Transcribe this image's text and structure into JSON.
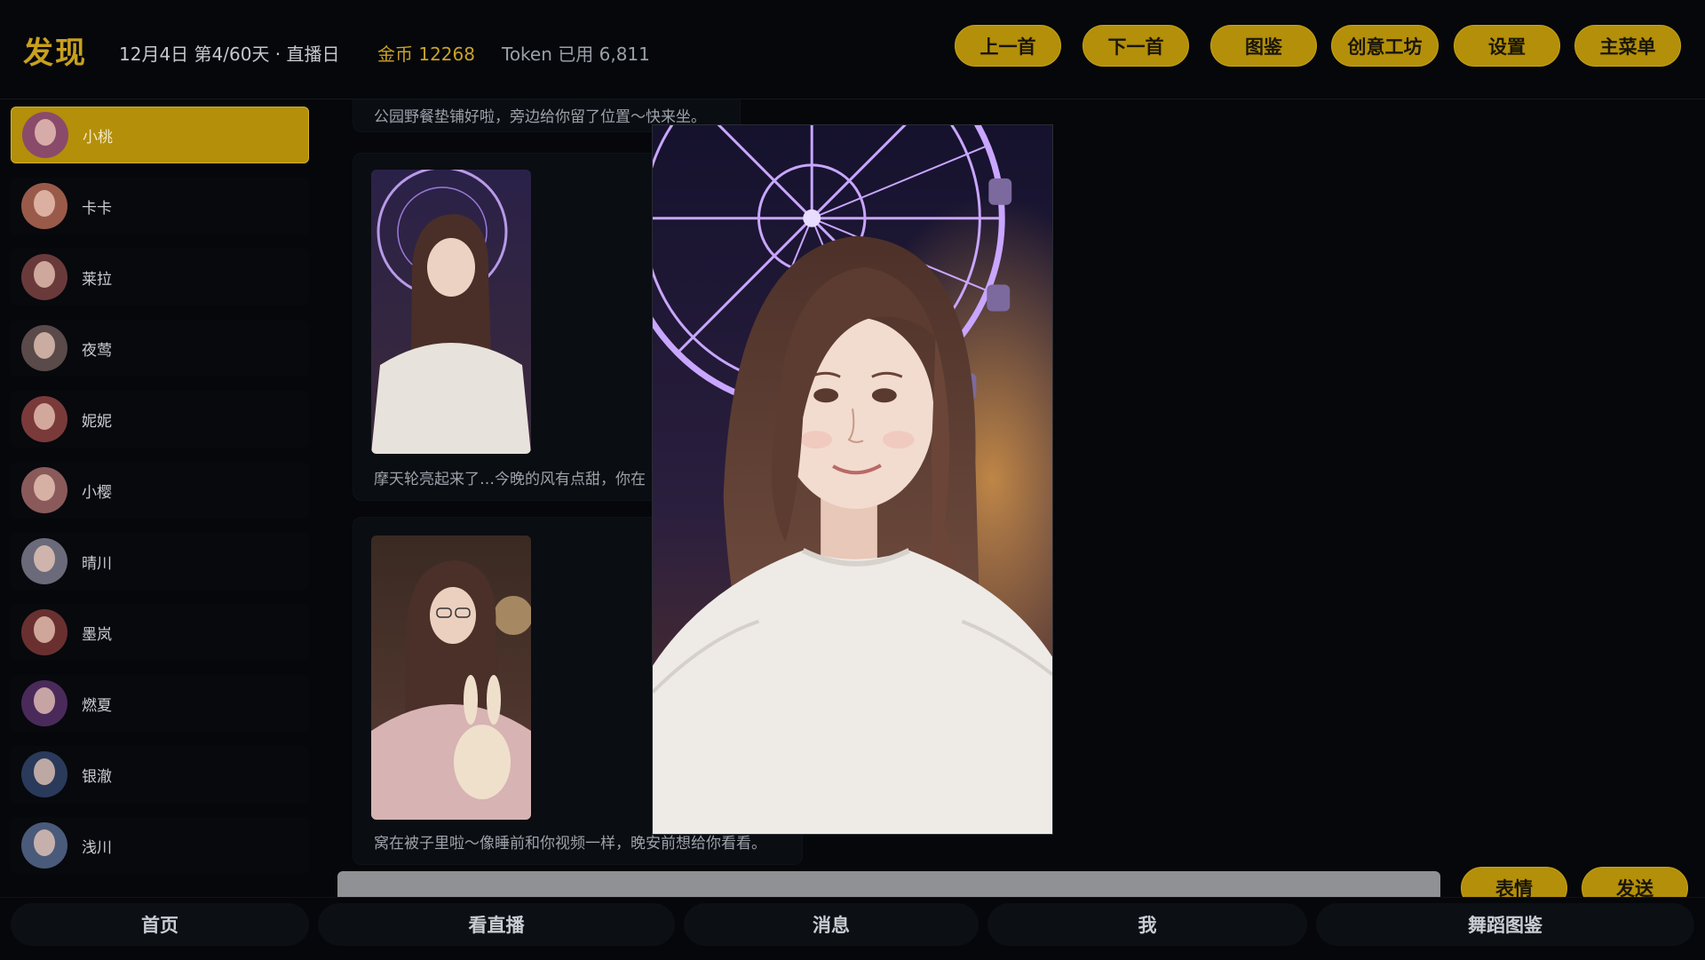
{
  "header": {
    "title": "发现",
    "date": "12月4日  第4/60天 · 直播日",
    "coins": "金币 12268",
    "token": "Token 已用 6,811",
    "buttons": [
      "上一首",
      "下一首",
      "图鉴",
      "创意工坊",
      "设置",
      "主菜单"
    ]
  },
  "sidebar": {
    "contacts": [
      {
        "name": "小桃",
        "active": true,
        "color": "#8a4a6a"
      },
      {
        "name": "卡卡",
        "active": false,
        "color": "#9a5a4a"
      },
      {
        "name": "莱拉",
        "active": false,
        "color": "#6a3a3a"
      },
      {
        "name": "夜莺",
        "active": false,
        "color": "#5a4a4a"
      },
      {
        "name": "妮妮",
        "active": false,
        "color": "#7a3a3a"
      },
      {
        "name": "小樱",
        "active": false,
        "color": "#8a5a5a"
      },
      {
        "name": "晴川",
        "active": false,
        "color": "#6a6a7a"
      },
      {
        "name": "墨岚",
        "active": false,
        "color": "#6a3030"
      },
      {
        "name": "燃夏",
        "active": false,
        "color": "#4a2a5a"
      },
      {
        "name": "银澈",
        "active": false,
        "color": "#2a3a5a"
      },
      {
        "name": "浅川",
        "active": false,
        "color": "#4a5a7a"
      }
    ]
  },
  "chat": {
    "messages": [
      {
        "text": "公园野餐垫铺好啦，旁边给你留了位置～快来坐。"
      },
      {
        "text": "摩天轮亮起来了…今晚的风有点甜，你在"
      },
      {
        "text": "窝在被子里啦～像睡前和你视频一样，晚安前想给你看看。"
      }
    ]
  },
  "input": {
    "value": "",
    "placeholder": "",
    "emoji_label": "表情",
    "send_label": "发送"
  },
  "nav": {
    "tabs": [
      "首页",
      "看直播",
      "消息",
      "我",
      "舞蹈图鉴"
    ]
  },
  "colors": {
    "accent": "#b38f0a",
    "background": "#05070b",
    "title_gold": "#c8a01e"
  },
  "icons": [
    "avatar-icon"
  ]
}
